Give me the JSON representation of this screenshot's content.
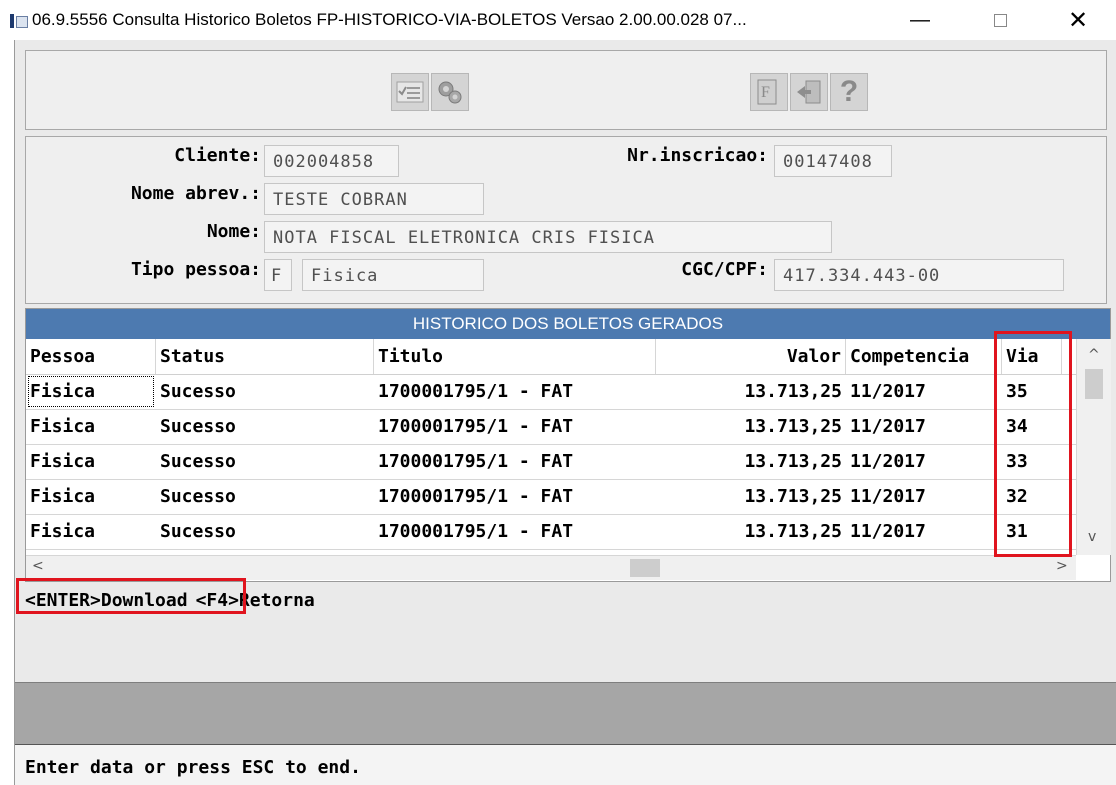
{
  "window": {
    "title": "06.9.5556 Consulta Historico Boletos FP-HISTORICO-VIA-BOLETOS Versao 2.00.00.028 07...",
    "minimize": "—",
    "close": "✕"
  },
  "toolbar": {
    "icons": [
      "checklist-icon",
      "config-gears-icon",
      "file-icon",
      "exit-door-icon",
      "help-icon"
    ],
    "help_glyph": "?",
    "file_glyph": "F"
  },
  "form": {
    "cliente_label": "Cliente:",
    "cliente_value": "002004858",
    "nrinscricao_label": "Nr.inscricao:",
    "nrinscricao_value": "00147408",
    "nomeabrev_label": "Nome abrev.:",
    "nomeabrev_value": "TESTE COBRAN",
    "nome_label": "Nome:",
    "nome_value": "NOTA FISCAL ELETRONICA CRIS FISICA",
    "tipopessoa_label": "Tipo pessoa:",
    "tipopessoa_code": "F",
    "tipopessoa_desc": "Fisica",
    "cgccpf_label": "CGC/CPF:",
    "cgccpf_value": "417.334.443-00"
  },
  "grid": {
    "caption": "HISTORICO DOS BOLETOS GERADOS",
    "columns": [
      "Pessoa",
      "Status",
      "Titulo",
      "Valor",
      "Competencia",
      "Via"
    ],
    "rows": [
      {
        "pessoa": "Fisica",
        "status": "Sucesso",
        "titulo": "1700001795/1 - FAT",
        "valor": "13.713,25",
        "competencia": "11/2017",
        "via": "35"
      },
      {
        "pessoa": "Fisica",
        "status": "Sucesso",
        "titulo": "1700001795/1 - FAT",
        "valor": "13.713,25",
        "competencia": "11/2017",
        "via": "34"
      },
      {
        "pessoa": "Fisica",
        "status": "Sucesso",
        "titulo": "1700001795/1 - FAT",
        "valor": "13.713,25",
        "competencia": "11/2017",
        "via": "33"
      },
      {
        "pessoa": "Fisica",
        "status": "Sucesso",
        "titulo": "1700001795/1 - FAT",
        "valor": "13.713,25",
        "competencia": "11/2017",
        "via": "32"
      },
      {
        "pessoa": "Fisica",
        "status": "Sucesso",
        "titulo": "1700001795/1 - FAT",
        "valor": "13.713,25",
        "competencia": "11/2017",
        "via": "31"
      }
    ]
  },
  "hotkeys": {
    "download": "<ENTER>Download",
    "retorna": "<F4>Retorna"
  },
  "status_text": "Enter data or press ESC to end.",
  "colors": {
    "caption_bg": "#4d7ab0",
    "highlight": "#e0141e"
  }
}
